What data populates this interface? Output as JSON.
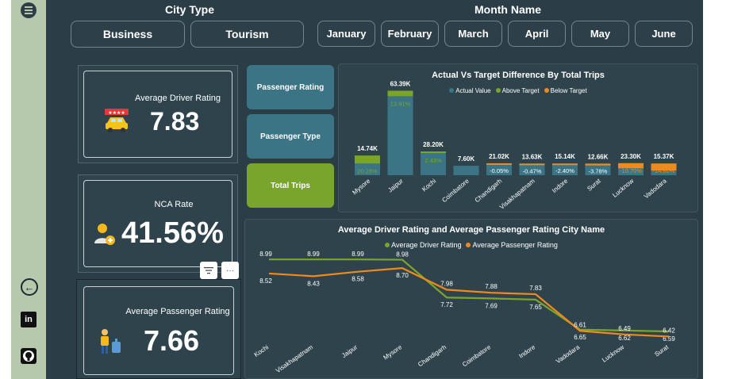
{
  "sidebar": {
    "menu_icon": "hamburger-icon",
    "back_icon": "arrow-left-icon",
    "linkedin_icon": "linkedin-icon",
    "linkedin_text": "in",
    "github_icon": "github-icon"
  },
  "filters": {
    "city_type_title": "City Type",
    "city_types": [
      "Business",
      "Tourism"
    ],
    "month_title": "Month Name",
    "months": [
      "January",
      "February",
      "March",
      "April",
      "May",
      "June"
    ]
  },
  "kpis": {
    "driver_rating": {
      "label": "Average Driver Rating",
      "value": "7.83",
      "icon": "taxi-icon"
    },
    "nca_rate": {
      "label": "NCA Rate",
      "value": "41.56%",
      "icon": "user-add-icon"
    },
    "passenger_rating": {
      "label": "Average Passenger Rating",
      "value": "7.66",
      "icon": "traveler-luggage-icon"
    }
  },
  "visual_toggles": [
    "Passenger Rating",
    "Passenger Type",
    "Total Trips"
  ],
  "colors": {
    "accent_green": "#7aa52c",
    "bar_blue": "#3a7485",
    "below_orange": "#f08a1c",
    "line_green": "#7aa52c",
    "line_orange": "#f08a1c"
  },
  "chart_data": [
    {
      "type": "bar",
      "title": "Actual Vs Target Difference By Total Trips",
      "legend": [
        "Actual Value",
        "Above Target",
        "Below Target"
      ],
      "categories": [
        "Mysore",
        "Jaipur",
        "Kochi",
        "Coimbatore",
        "Chandigarh",
        "Visakhapatnam",
        "Indore",
        "Surat",
        "Lucknow",
        "Vadodara"
      ],
      "actual_labels": [
        "14.74K",
        "63.39K",
        "28.20K",
        "7.60K",
        "21.02K",
        "13.63K",
        "15.14K",
        "12.66K",
        "23.30K",
        "15.37K"
      ],
      "actual_values": [
        14.74,
        63.39,
        28.2,
        7.6,
        21.02,
        13.63,
        15.14,
        12.66,
        23.3,
        15.37
      ],
      "difference_labels": [
        "20.28%",
        "13.91%",
        "2.43%",
        "",
        "-0.05%",
        "-0.47%",
        "-2.40%",
        "-3.78%",
        "-10.70%",
        "-14.60%"
      ],
      "difference_pct": [
        20.28,
        13.91,
        2.43,
        0,
        -0.05,
        -0.47,
        -2.4,
        -3.78,
        -10.7,
        -14.6
      ]
    },
    {
      "type": "line",
      "title": "Average Driver Rating and Average Passenger Rating City Name",
      "categories": [
        "Kochi",
        "Visakhapatnam",
        "Jaipur",
        "Mysore",
        "Chandigarh",
        "Coimbatore",
        "Indore",
        "Vadodara",
        "Lucknow",
        "Surat"
      ],
      "series": [
        {
          "name": "Average Driver Rating",
          "values": [
            8.99,
            8.99,
            8.99,
            8.98,
            7.72,
            7.69,
            7.65,
            6.65,
            6.62,
            6.59
          ]
        },
        {
          "name": "Average Passenger Rating",
          "values": [
            8.52,
            8.43,
            8.58,
            8.7,
            7.98,
            7.88,
            7.83,
            6.61,
            6.49,
            6.42
          ]
        }
      ]
    }
  ],
  "buttons": {
    "filter_icon": "filter-icon",
    "more_icon": "more-options-icon",
    "more_text": "···"
  }
}
